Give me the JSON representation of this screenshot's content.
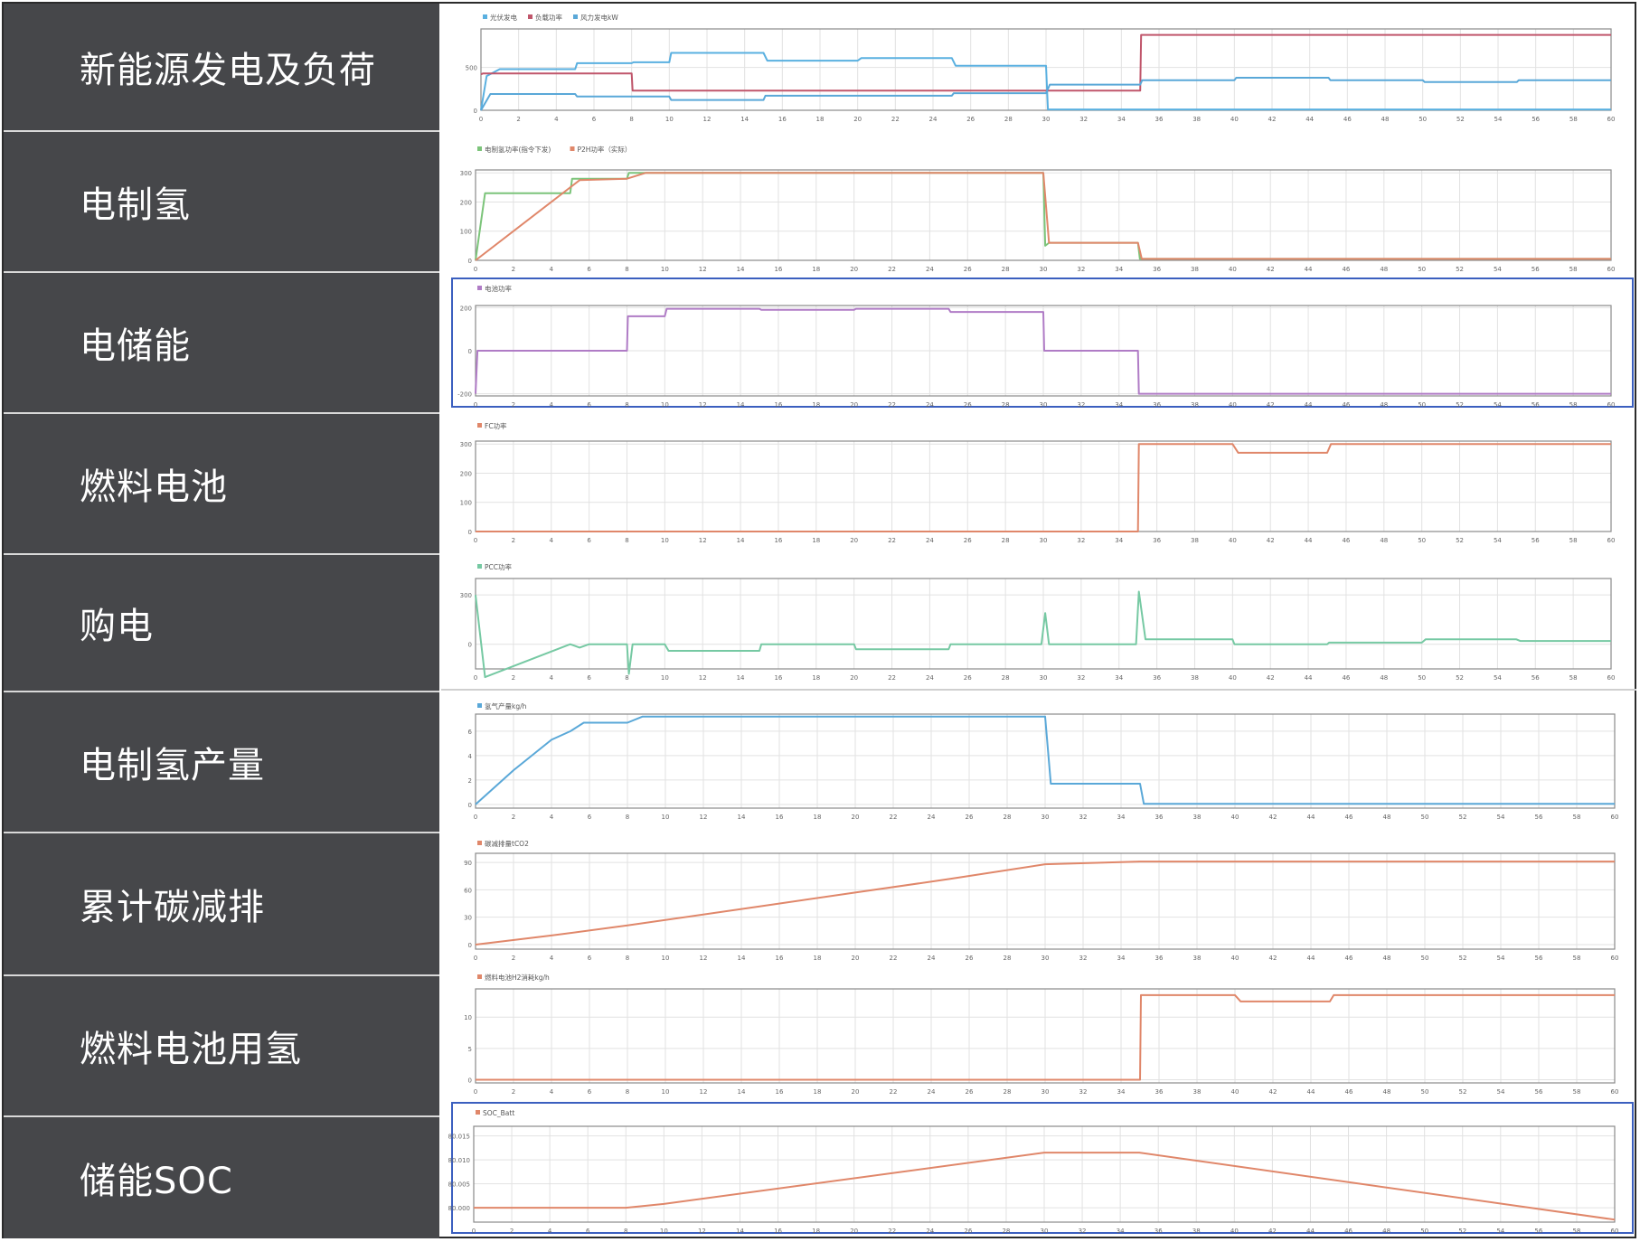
{
  "labels": {
    "row1": "新能源发电及负荷",
    "row2": "电制氢",
    "row3": "电储能",
    "row4": "燃料电池",
    "row5": "购电",
    "row6": "电制氢产量",
    "row7": "累计碳减排",
    "row8": "燃料电池用氢",
    "row9": "储能SOC"
  },
  "colors": {
    "label_bg": "#46474a",
    "label_text": "#ffffff",
    "highlight_border": "#3b5fbf"
  },
  "chart_data": [
    {
      "type": "line",
      "legend": [
        "光伏发电",
        "负载功率",
        "风力发电kW"
      ],
      "xlim": [
        0,
        60
      ],
      "ylim": [
        0,
        950
      ],
      "xticks": [
        0,
        2,
        4,
        6,
        8,
        10,
        12,
        14,
        16,
        18,
        20,
        22,
        24,
        26,
        28,
        30,
        32,
        34,
        36,
        38,
        40,
        42,
        44,
        46,
        48,
        50,
        52,
        54,
        56,
        58,
        60
      ],
      "yticks": [
        0,
        500
      ],
      "highlight": false,
      "series": [
        {
          "name": "光伏发电",
          "color": "#5ab0e0",
          "x": [
            0,
            0.3,
            1,
            5,
            5.1,
            8,
            8.1,
            10,
            10.1,
            15,
            15.2,
            20,
            20.2,
            25,
            25.2,
            30,
            30.1,
            60
          ],
          "y": [
            0,
            400,
            480,
            480,
            550,
            550,
            560,
            560,
            670,
            670,
            580,
            580,
            610,
            610,
            520,
            520,
            10,
            10
          ]
        },
        {
          "name": "负载功率",
          "color": "#c0566b",
          "x": [
            0,
            0.1,
            8,
            8.05,
            35,
            35.05,
            60
          ],
          "y": [
            420,
            430,
            430,
            230,
            230,
            880,
            880
          ]
        },
        {
          "name": "风力发电kW",
          "color": "#5aa8d8",
          "x": [
            0,
            0.5,
            5,
            5.1,
            10,
            10.1,
            15,
            15.1,
            25,
            25.1,
            30,
            30.2,
            35,
            35.1,
            40,
            40.1,
            45,
            45.1,
            50,
            50.1,
            55,
            55.1,
            60
          ],
          "y": [
            0,
            190,
            190,
            160,
            160,
            120,
            120,
            170,
            170,
            200,
            200,
            300,
            300,
            350,
            350,
            380,
            380,
            350,
            350,
            330,
            330,
            350,
            350
          ]
        }
      ]
    },
    {
      "type": "line",
      "legend": [
        "电制氢功率(指令下发)",
        "P2H功率（实际）"
      ],
      "xlim": [
        0,
        60
      ],
      "ylim": [
        0,
        310
      ],
      "xticks": [
        0,
        2,
        4,
        6,
        8,
        10,
        12,
        14,
        16,
        18,
        20,
        22,
        24,
        26,
        28,
        30,
        32,
        34,
        36,
        38,
        40,
        42,
        44,
        46,
        48,
        50,
        52,
        54,
        56,
        58,
        60
      ],
      "yticks": [
        0,
        100,
        200,
        300
      ],
      "highlight": false,
      "series": [
        {
          "name": "电制氢功率(指令下发)",
          "color": "#7cc47a",
          "x": [
            0,
            0.5,
            5,
            5.1,
            8,
            8.1,
            30,
            30.1,
            30.3,
            35,
            35.1,
            60
          ],
          "y": [
            0,
            230,
            230,
            280,
            280,
            300,
            300,
            50,
            60,
            60,
            5,
            5
          ]
        },
        {
          "name": "P2H功率（实际）",
          "color": "#e0876a",
          "x": [
            0,
            5.5,
            8,
            9,
            30,
            30.3,
            35,
            35.2,
            60
          ],
          "y": [
            0,
            275,
            280,
            300,
            300,
            60,
            60,
            5,
            5
          ]
        }
      ]
    },
    {
      "type": "line",
      "legend": [
        "电池功率"
      ],
      "xlim": [
        0,
        60
      ],
      "ylim": [
        -210,
        210
      ],
      "xticks": [
        0,
        2,
        4,
        6,
        8,
        10,
        12,
        14,
        16,
        18,
        20,
        22,
        24,
        26,
        28,
        30,
        32,
        34,
        36,
        38,
        40,
        42,
        44,
        46,
        48,
        50,
        52,
        54,
        56,
        58,
        60
      ],
      "yticks": [
        -200,
        0,
        200
      ],
      "highlight": true,
      "series": [
        {
          "name": "电池功率",
          "color": "#b07cc6",
          "x": [
            0,
            0.1,
            8,
            8.05,
            10,
            10.1,
            15,
            15.1,
            20,
            20.1,
            25,
            25.1,
            30,
            30.05,
            35,
            35.05,
            60
          ],
          "y": [
            -200,
            0,
            0,
            160,
            160,
            195,
            195,
            190,
            190,
            195,
            195,
            180,
            180,
            0,
            0,
            -200,
            -200
          ]
        }
      ]
    },
    {
      "type": "line",
      "legend": [
        "FC功率"
      ],
      "xlim": [
        0,
        60
      ],
      "ylim": [
        0,
        310
      ],
      "xticks": [
        0,
        2,
        4,
        6,
        8,
        10,
        12,
        14,
        16,
        18,
        20,
        22,
        24,
        26,
        28,
        30,
        32,
        34,
        36,
        38,
        40,
        42,
        44,
        46,
        48,
        50,
        52,
        54,
        56,
        58,
        60
      ],
      "yticks": [
        0,
        100,
        200,
        300
      ],
      "highlight": false,
      "series": [
        {
          "name": "FC功率",
          "color": "#e0876a",
          "x": [
            0,
            35,
            35.05,
            40,
            40.3,
            45,
            45.2,
            60
          ],
          "y": [
            0,
            0,
            300,
            300,
            270,
            270,
            300,
            300
          ]
        }
      ]
    },
    {
      "type": "line",
      "legend": [
        "PCC功率"
      ],
      "xlim": [
        0,
        60
      ],
      "ylim": [
        -150,
        400
      ],
      "xticks": [
        0,
        2,
        4,
        6,
        8,
        10,
        12,
        14,
        16,
        18,
        20,
        22,
        24,
        26,
        28,
        30,
        32,
        34,
        36,
        38,
        40,
        42,
        44,
        46,
        48,
        50,
        52,
        54,
        56,
        58,
        60
      ],
      "yticks": [
        0,
        300
      ],
      "highlight": false,
      "series": [
        {
          "name": "PCC功率",
          "color": "#76c9a3",
          "x": [
            0,
            0.5,
            5,
            5.5,
            6,
            8,
            8.1,
            8.3,
            10,
            10.2,
            15,
            15.1,
            20,
            20.1,
            25,
            25.1,
            29.9,
            30.1,
            30.3,
            34.9,
            35.05,
            35.4,
            40,
            40.1,
            45,
            45.1,
            50,
            50.2,
            55,
            55.2,
            60
          ],
          "y": [
            300,
            -200,
            0,
            -20,
            0,
            0,
            -180,
            0,
            0,
            -40,
            -40,
            0,
            0,
            -30,
            -30,
            0,
            0,
            190,
            0,
            0,
            320,
            30,
            30,
            0,
            0,
            10,
            10,
            30,
            30,
            20,
            20
          ]
        }
      ]
    },
    {
      "type": "line",
      "legend": [
        "氢气产量kg/h"
      ],
      "xlim": [
        0,
        60
      ],
      "ylim": [
        -0.3,
        7.4
      ],
      "xticks": [
        0,
        2,
        4,
        6,
        8,
        10,
        12,
        14,
        16,
        18,
        20,
        22,
        24,
        26,
        28,
        30,
        32,
        34,
        36,
        38,
        40,
        42,
        44,
        46,
        48,
        50,
        52,
        54,
        56,
        58,
        60
      ],
      "yticks": [
        0,
        2,
        4,
        6
      ],
      "highlight": false,
      "series": [
        {
          "name": "氢气产量kg/h",
          "color": "#5aa8d8",
          "x": [
            0,
            2,
            4,
            5,
            5.7,
            8,
            8.8,
            30,
            30.3,
            35,
            35.2,
            60
          ],
          "y": [
            0,
            2.8,
            5.3,
            6.0,
            6.7,
            6.7,
            7.2,
            7.2,
            1.7,
            1.7,
            0.05,
            0.05
          ]
        }
      ]
    },
    {
      "type": "line",
      "legend": [
        "碳减排量tCO2"
      ],
      "xlim": [
        0,
        60
      ],
      "ylim": [
        -5,
        100
      ],
      "xticks": [
        0,
        2,
        4,
        6,
        8,
        10,
        12,
        14,
        16,
        18,
        20,
        22,
        24,
        26,
        28,
        30,
        32,
        34,
        36,
        38,
        40,
        42,
        44,
        46,
        48,
        50,
        52,
        54,
        56,
        58,
        60
      ],
      "yticks": [
        0,
        30,
        60,
        90
      ],
      "highlight": false,
      "series": [
        {
          "name": "碳减排量tCO2",
          "color": "#e0876a",
          "x": [
            0,
            4,
            8,
            15,
            20,
            25,
            30,
            35,
            60
          ],
          "y": [
            0,
            10,
            21,
            42,
            57,
            72,
            88,
            91,
            91
          ]
        }
      ]
    },
    {
      "type": "line",
      "legend": [
        "燃料电池H2消耗kg/h"
      ],
      "xlim": [
        0,
        60
      ],
      "ylim": [
        -0.5,
        14.5
      ],
      "xticks": [
        0,
        2,
        4,
        6,
        8,
        10,
        12,
        14,
        16,
        18,
        20,
        22,
        24,
        26,
        28,
        30,
        32,
        34,
        36,
        38,
        40,
        42,
        44,
        46,
        48,
        50,
        52,
        54,
        56,
        58,
        60
      ],
      "yticks": [
        0,
        5,
        10
      ],
      "highlight": false,
      "series": [
        {
          "name": "燃料电池H2消耗kg/h",
          "color": "#e0876a",
          "x": [
            0,
            35,
            35.05,
            40,
            40.3,
            45,
            45.2,
            60
          ],
          "y": [
            0,
            0,
            13.5,
            13.5,
            12.5,
            12.5,
            13.5,
            13.5
          ]
        }
      ]
    },
    {
      "type": "line",
      "legend": [
        "SOC_Batt"
      ],
      "xlim": [
        0,
        60
      ],
      "ylim": [
        79.997,
        80.017
      ],
      "xticks": [
        0,
        2,
        4,
        6,
        8,
        10,
        12,
        14,
        16,
        18,
        20,
        22,
        24,
        26,
        28,
        30,
        32,
        34,
        36,
        38,
        40,
        42,
        44,
        46,
        48,
        50,
        52,
        54,
        56,
        58,
        60
      ],
      "yticks": [
        80.0,
        80.005,
        80.01,
        80.015
      ],
      "ytick_labels": [
        "80.000",
        "80.005",
        "80.010",
        "80.015"
      ],
      "highlight": true,
      "series": [
        {
          "name": "SOC_Batt",
          "color": "#e0876a",
          "x": [
            0,
            8,
            10,
            30,
            35,
            60
          ],
          "y": [
            80.0,
            80.0,
            80.0008,
            80.0115,
            80.0115,
            79.9975
          ]
        }
      ]
    }
  ]
}
